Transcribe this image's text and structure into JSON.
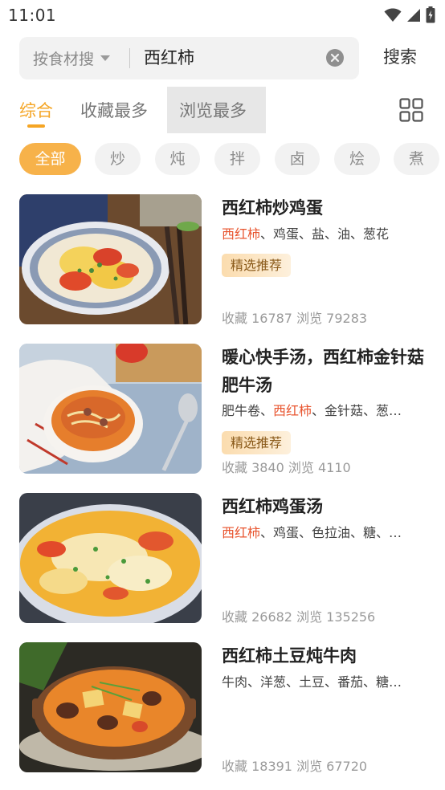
{
  "status_bar": {
    "time": "11:01"
  },
  "search": {
    "filter_label": "按食材搜",
    "value": "西红柿",
    "submit_label": "搜索"
  },
  "sort_tabs": [
    {
      "label": "综合",
      "active": true
    },
    {
      "label": "收藏最多",
      "active": false
    },
    {
      "label": "浏览最多",
      "active": false
    }
  ],
  "categories": [
    "全部",
    "炒",
    "炖",
    "拌",
    "卤",
    "烩",
    "煮"
  ],
  "active_category": "全部",
  "colors": {
    "accent": "#f5a524",
    "highlight": "#e8542e",
    "chip_active": "#f7b24a"
  },
  "recipes": [
    {
      "title": "西红柿炒鸡蛋",
      "ingredients_highlight": "西红柿",
      "ingredients_rest": "、鸡蛋、盐、油、葱花",
      "badge": "精选推荐",
      "stats": "收藏 16787 浏览 79283"
    },
    {
      "title": "暖心快手汤，西红柿金针菇肥牛汤",
      "ingredients_prefix": "肥牛卷、",
      "ingredients_highlight": "西红柿",
      "ingredients_rest": "、金针菇、葱…",
      "badge": "精选推荐",
      "stats": "收藏 3840 浏览 4110"
    },
    {
      "title": "西红柿鸡蛋汤",
      "ingredients_highlight": "西红柿",
      "ingredients_rest": "、鸡蛋、色拉油、糖、…",
      "stats": "收藏 26682 浏览 135256"
    },
    {
      "title": "西红柿土豆炖牛肉",
      "ingredients_rest": "牛肉、洋葱、土豆、番茄、糖…",
      "stats": "收藏 18391 浏览 67720"
    }
  ]
}
